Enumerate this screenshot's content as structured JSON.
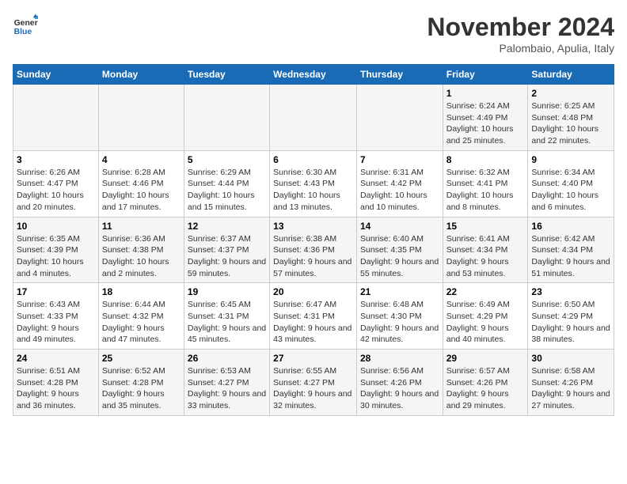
{
  "logo": {
    "line1": "General",
    "line2": "Blue"
  },
  "title": "November 2024",
  "subtitle": "Palombaio, Apulia, Italy",
  "weekdays": [
    "Sunday",
    "Monday",
    "Tuesday",
    "Wednesday",
    "Thursday",
    "Friday",
    "Saturday"
  ],
  "rows": [
    [
      {
        "day": "",
        "info": ""
      },
      {
        "day": "",
        "info": ""
      },
      {
        "day": "",
        "info": ""
      },
      {
        "day": "",
        "info": ""
      },
      {
        "day": "",
        "info": ""
      },
      {
        "day": "1",
        "info": "Sunrise: 6:24 AM\nSunset: 4:49 PM\nDaylight: 10 hours and 25 minutes."
      },
      {
        "day": "2",
        "info": "Sunrise: 6:25 AM\nSunset: 4:48 PM\nDaylight: 10 hours and 22 minutes."
      }
    ],
    [
      {
        "day": "3",
        "info": "Sunrise: 6:26 AM\nSunset: 4:47 PM\nDaylight: 10 hours and 20 minutes."
      },
      {
        "day": "4",
        "info": "Sunrise: 6:28 AM\nSunset: 4:46 PM\nDaylight: 10 hours and 17 minutes."
      },
      {
        "day": "5",
        "info": "Sunrise: 6:29 AM\nSunset: 4:44 PM\nDaylight: 10 hours and 15 minutes."
      },
      {
        "day": "6",
        "info": "Sunrise: 6:30 AM\nSunset: 4:43 PM\nDaylight: 10 hours and 13 minutes."
      },
      {
        "day": "7",
        "info": "Sunrise: 6:31 AM\nSunset: 4:42 PM\nDaylight: 10 hours and 10 minutes."
      },
      {
        "day": "8",
        "info": "Sunrise: 6:32 AM\nSunset: 4:41 PM\nDaylight: 10 hours and 8 minutes."
      },
      {
        "day": "9",
        "info": "Sunrise: 6:34 AM\nSunset: 4:40 PM\nDaylight: 10 hours and 6 minutes."
      }
    ],
    [
      {
        "day": "10",
        "info": "Sunrise: 6:35 AM\nSunset: 4:39 PM\nDaylight: 10 hours and 4 minutes."
      },
      {
        "day": "11",
        "info": "Sunrise: 6:36 AM\nSunset: 4:38 PM\nDaylight: 10 hours and 2 minutes."
      },
      {
        "day": "12",
        "info": "Sunrise: 6:37 AM\nSunset: 4:37 PM\nDaylight: 9 hours and 59 minutes."
      },
      {
        "day": "13",
        "info": "Sunrise: 6:38 AM\nSunset: 4:36 PM\nDaylight: 9 hours and 57 minutes."
      },
      {
        "day": "14",
        "info": "Sunrise: 6:40 AM\nSunset: 4:35 PM\nDaylight: 9 hours and 55 minutes."
      },
      {
        "day": "15",
        "info": "Sunrise: 6:41 AM\nSunset: 4:34 PM\nDaylight: 9 hours and 53 minutes."
      },
      {
        "day": "16",
        "info": "Sunrise: 6:42 AM\nSunset: 4:34 PM\nDaylight: 9 hours and 51 minutes."
      }
    ],
    [
      {
        "day": "17",
        "info": "Sunrise: 6:43 AM\nSunset: 4:33 PM\nDaylight: 9 hours and 49 minutes."
      },
      {
        "day": "18",
        "info": "Sunrise: 6:44 AM\nSunset: 4:32 PM\nDaylight: 9 hours and 47 minutes."
      },
      {
        "day": "19",
        "info": "Sunrise: 6:45 AM\nSunset: 4:31 PM\nDaylight: 9 hours and 45 minutes."
      },
      {
        "day": "20",
        "info": "Sunrise: 6:47 AM\nSunset: 4:31 PM\nDaylight: 9 hours and 43 minutes."
      },
      {
        "day": "21",
        "info": "Sunrise: 6:48 AM\nSunset: 4:30 PM\nDaylight: 9 hours and 42 minutes."
      },
      {
        "day": "22",
        "info": "Sunrise: 6:49 AM\nSunset: 4:29 PM\nDaylight: 9 hours and 40 minutes."
      },
      {
        "day": "23",
        "info": "Sunrise: 6:50 AM\nSunset: 4:29 PM\nDaylight: 9 hours and 38 minutes."
      }
    ],
    [
      {
        "day": "24",
        "info": "Sunrise: 6:51 AM\nSunset: 4:28 PM\nDaylight: 9 hours and 36 minutes."
      },
      {
        "day": "25",
        "info": "Sunrise: 6:52 AM\nSunset: 4:28 PM\nDaylight: 9 hours and 35 minutes."
      },
      {
        "day": "26",
        "info": "Sunrise: 6:53 AM\nSunset: 4:27 PM\nDaylight: 9 hours and 33 minutes."
      },
      {
        "day": "27",
        "info": "Sunrise: 6:55 AM\nSunset: 4:27 PM\nDaylight: 9 hours and 32 minutes."
      },
      {
        "day": "28",
        "info": "Sunrise: 6:56 AM\nSunset: 4:26 PM\nDaylight: 9 hours and 30 minutes."
      },
      {
        "day": "29",
        "info": "Sunrise: 6:57 AM\nSunset: 4:26 PM\nDaylight: 9 hours and 29 minutes."
      },
      {
        "day": "30",
        "info": "Sunrise: 6:58 AM\nSunset: 4:26 PM\nDaylight: 9 hours and 27 minutes."
      }
    ]
  ]
}
